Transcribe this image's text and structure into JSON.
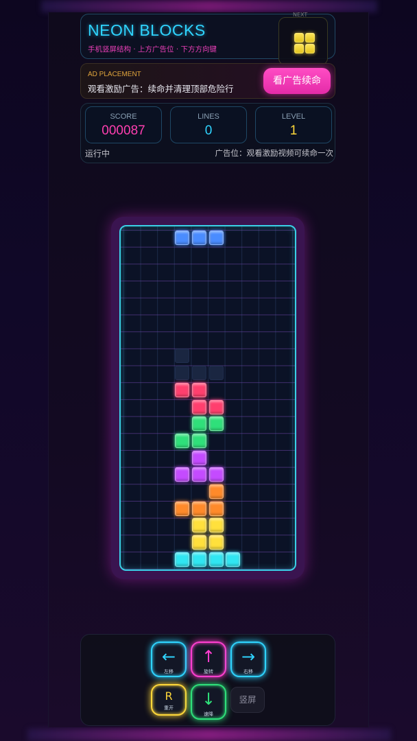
{
  "header": {
    "title": "NEON BLOCKS",
    "subtitle": "手机竖屏结构 · 上方广告位 · 下方方向键",
    "next_label": "NEXT",
    "next_piece_color": "#ffe03c"
  },
  "ad": {
    "label": "AD PLACEMENT",
    "text": "观看激励广告：续命并清理顶部危险行",
    "button": "看广告续命"
  },
  "stats": {
    "score": {
      "title": "SCORE",
      "value": "000087",
      "color": "#ff3fb0"
    },
    "lines": {
      "title": "LINES",
      "value": "0",
      "color": "#2fd4ff"
    },
    "level": {
      "title": "LEVEL",
      "value": "1",
      "color": "#ffd83a"
    },
    "status": "运行中",
    "ad_hint": "广告位：观看激励视频可续命一次"
  },
  "board": {
    "columns": 10,
    "rows": 20,
    "colors": {
      "blue": "#4a8cff",
      "ghost": "#1e2c48",
      "red": "#ff3f6e",
      "green": "#2fe07a",
      "purple": "#c44bff",
      "orange": "#ff8a2a",
      "yellow": "#ffe03c",
      "cyan": "#30e6f2"
    },
    "active_piece": {
      "color": "blue",
      "cells": [
        [
          3,
          0
        ],
        [
          4,
          0
        ],
        [
          5,
          0
        ]
      ]
    },
    "ghost_cells": [
      [
        3,
        7
      ],
      [
        3,
        8
      ],
      [
        4,
        8
      ],
      [
        5,
        8
      ]
    ],
    "locked": [
      {
        "color": "red",
        "cells": [
          [
            3,
            9
          ],
          [
            4,
            9
          ],
          [
            4,
            10
          ],
          [
            5,
            10
          ]
        ]
      },
      {
        "color": "green",
        "cells": [
          [
            4,
            11
          ],
          [
            5,
            11
          ],
          [
            3,
            12
          ],
          [
            4,
            12
          ]
        ]
      },
      {
        "color": "purple",
        "cells": [
          [
            4,
            13
          ],
          [
            3,
            14
          ],
          [
            4,
            14
          ],
          [
            5,
            14
          ]
        ]
      },
      {
        "color": "orange",
        "cells": [
          [
            5,
            15
          ],
          [
            3,
            16
          ],
          [
            4,
            16
          ],
          [
            5,
            16
          ]
        ]
      },
      {
        "color": "yellow",
        "cells": [
          [
            4,
            17
          ],
          [
            5,
            17
          ],
          [
            4,
            18
          ],
          [
            5,
            18
          ]
        ]
      },
      {
        "color": "cyan",
        "cells": [
          [
            3,
            19
          ],
          [
            4,
            19
          ],
          [
            5,
            19
          ],
          [
            6,
            19
          ]
        ]
      }
    ]
  },
  "controls": {
    "left": {
      "symbol": "←",
      "label": "左移",
      "color": "#2fd4ff"
    },
    "rotate": {
      "symbol": "↑",
      "label": "旋转",
      "color": "#ff3fd0"
    },
    "right": {
      "symbol": "→",
      "label": "右移",
      "color": "#2fd4ff"
    },
    "restart": {
      "symbol": "R",
      "label": "重开",
      "color": "#ffd83a"
    },
    "drop": {
      "symbol": "↓",
      "label": "速降",
      "color": "#2fe07a"
    },
    "portrait": {
      "label": "竖屏"
    }
  }
}
